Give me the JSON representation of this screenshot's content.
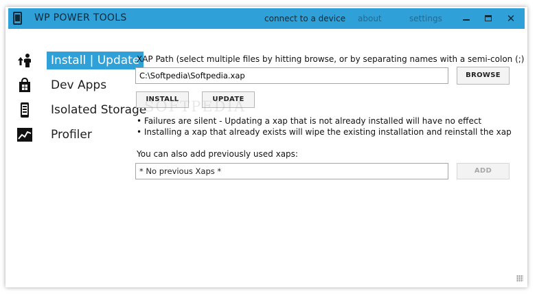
{
  "window": {
    "title": "WP POWER TOOLS",
    "controls": {
      "minimize": "",
      "maximize": "",
      "close": "✕"
    }
  },
  "titlebar_nav": {
    "connect": "connect to a device",
    "about": "about",
    "settings": "settings"
  },
  "sidebar": {
    "items": [
      {
        "label": "Install | Update",
        "icon": "install-update-icon",
        "active": true
      },
      {
        "label": "Dev Apps",
        "icon": "shopping-bag-icon",
        "active": false
      },
      {
        "label": "Isolated Storage",
        "icon": "phone-storage-icon",
        "active": false
      },
      {
        "label": "Profiler",
        "icon": "chart-line-icon",
        "active": false
      }
    ]
  },
  "main": {
    "xap_path_label": "XAP Path (select multiple files by hitting browse, or by separating names with a semi-colon (;) ):",
    "xap_path_value": "C:\\Softpedia\\Softpedia.xap",
    "browse_label": "BROWSE",
    "install_label": "INSTALL",
    "update_label": "UPDATE",
    "notes": [
      "• Failures are silent - Updating a xap that is not already installed will have no effect",
      "• Installing a xap that already exists will wipe the existing installation and reinstall the xap"
    ],
    "previous_label": "You can also add previously used xaps:",
    "previous_value": "* No previous Xaps *",
    "add_label": "ADD"
  },
  "watermark": "SOFTPEDIA",
  "colors": {
    "accent": "#2fa0d8",
    "title_text": "#0b2a3a",
    "nav_link": "#1f6c95"
  }
}
